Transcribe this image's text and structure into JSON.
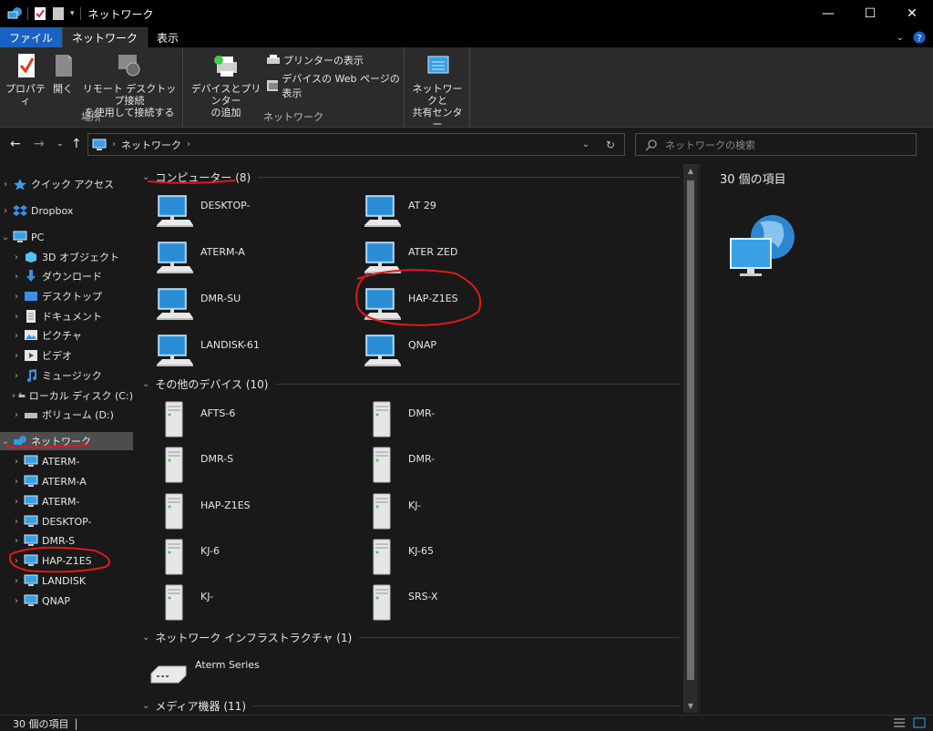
{
  "window": {
    "title": "ネットワーク"
  },
  "ribbon_tabs": [
    {
      "label": "ファイル"
    },
    {
      "label": "ネットワーク"
    },
    {
      "label": "表示"
    }
  ],
  "ribbon": {
    "group_place": {
      "label": "場所",
      "properties": "プロパティ",
      "open": "開く",
      "remote_line1": "リモート デスクトップ接続",
      "remote_line2": "を使用して接続する"
    },
    "group_network": {
      "label": "ネットワーク",
      "add_devices_line1": "デバイスとプリンター",
      "add_devices_line2": "の追加",
      "show_printers": "プリンターの表示",
      "show_device_web": "デバイスの Web ページの表示",
      "net_center_line1": "ネットワークと",
      "net_center_line2": "共有センター"
    }
  },
  "address": {
    "crumb": "ネットワーク",
    "search_placeholder": "ネットワークの検索"
  },
  "nav": {
    "quick_access": "クイック アクセス",
    "dropbox": "Dropbox",
    "pc": "PC",
    "pc_children": [
      "3D オブジェクト",
      "ダウンロード",
      "デスクトップ",
      "ドキュメント",
      "ピクチャ",
      "ビデオ",
      "ミュージック",
      "ローカル ディスク (C:)",
      "ボリューム (D:)"
    ],
    "network": "ネットワーク",
    "network_children": [
      "ATERM-",
      "ATERM-A",
      "ATERM-",
      "DESKTOP-",
      "DMR-S",
      "HAP-Z1ES",
      "LANDISK",
      "QNAP"
    ]
  },
  "groups": {
    "computers": {
      "header": "コンピューター (8)",
      "items": [
        "DESKTOP-",
        "AT          29",
        "ATERM-A",
        "ATER        ZED",
        "DMR-SU",
        "HAP-Z1ES",
        "LANDISK-61",
        "QNAP"
      ]
    },
    "other_devices": {
      "header": "その他のデバイス (10)",
      "items": [
        "AFTS-6",
        "DMR-",
        "DMR-S",
        "DMR-",
        "HAP-Z1ES",
        "KJ-",
        "KJ-6",
        "KJ-65",
        "KJ-",
        "SRS-X"
      ]
    },
    "infrastructure": {
      "header": "ネットワーク インフラストラクチャ (1)",
      "items": [
        "Aterm Series"
      ]
    },
    "media": {
      "header": "メディア機器 (11)"
    }
  },
  "details": {
    "count": "30 個の項目"
  },
  "status": {
    "text": "30 個の項目"
  },
  "colors": {
    "accent_blue": "#1a61c4",
    "background": "#191919",
    "annotation_red": "#e0191b"
  }
}
